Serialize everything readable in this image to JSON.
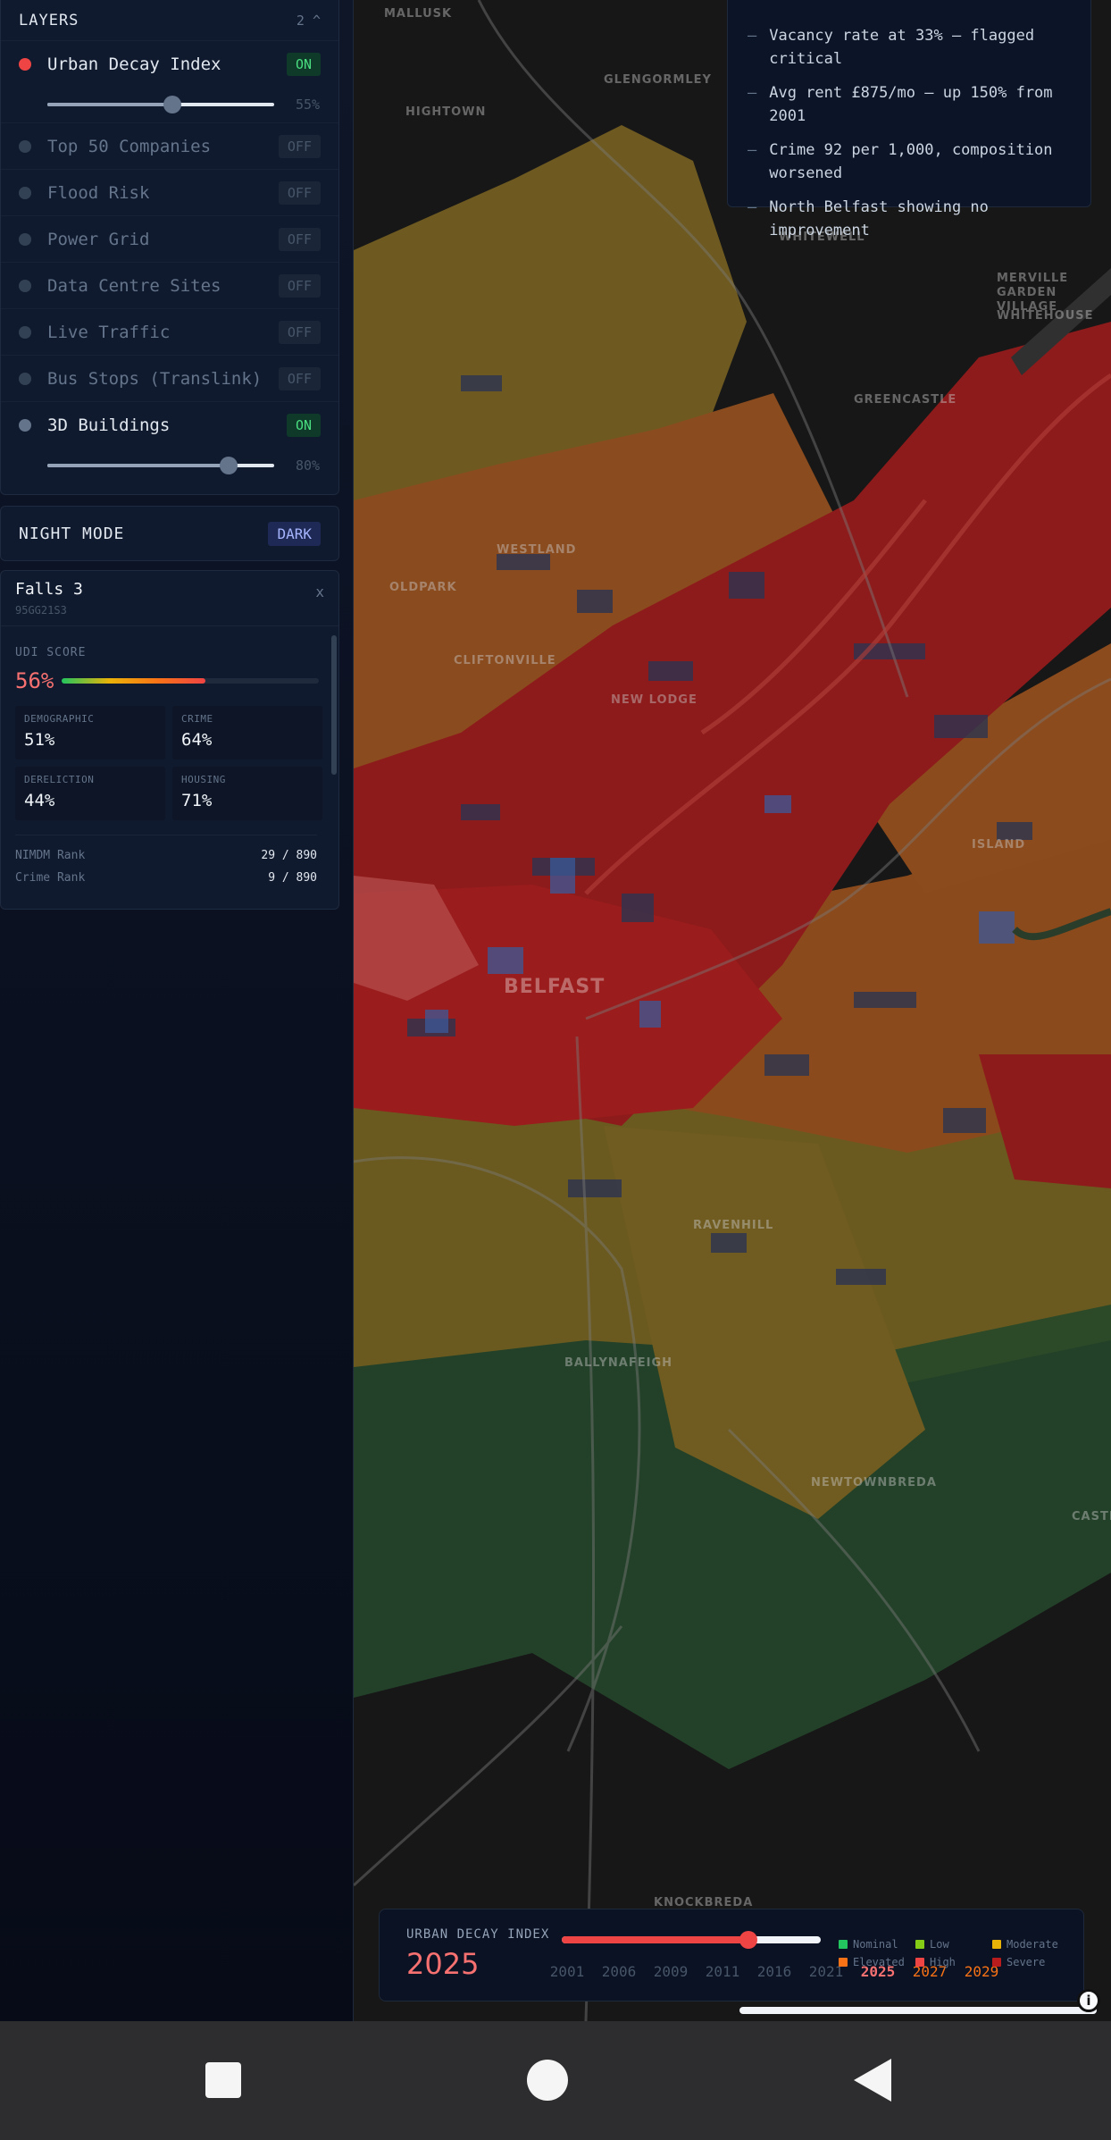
{
  "layers": {
    "title": "LAYERS",
    "count": "2 ^",
    "items": [
      {
        "name": "Urban Decay Index",
        "state": "ON",
        "dot": "red",
        "slider": 0.55,
        "slider_label": "55%"
      },
      {
        "name": "Top 50 Companies",
        "state": "OFF"
      },
      {
        "name": "Flood Risk",
        "state": "OFF"
      },
      {
        "name": "Power Grid",
        "state": "OFF"
      },
      {
        "name": "Data Centre Sites",
        "state": "OFF"
      },
      {
        "name": "Live Traffic",
        "state": "OFF"
      },
      {
        "name": "Bus Stops (Translink)",
        "state": "OFF"
      },
      {
        "name": "3D Buildings",
        "state": "ON",
        "dot": "slate",
        "slider": 0.8,
        "slider_label": "80%"
      }
    ]
  },
  "night_mode": {
    "label": "NIGHT MODE",
    "value": "DARK"
  },
  "detail": {
    "title": "Falls 3",
    "code": "95GG21S3",
    "close": "x",
    "udi_label": "UDI SCORE",
    "udi_value": "56%",
    "udi_fraction": 0.56,
    "metrics": [
      {
        "label": "DEMOGRAPHIC",
        "value": "51%"
      },
      {
        "label": "CRIME",
        "value": "64%"
      },
      {
        "label": "DERELICTION",
        "value": "44%"
      },
      {
        "label": "HOUSING",
        "value": "71%"
      }
    ],
    "ranks": [
      {
        "label": "NIMDM Rank",
        "value": "29 / 890"
      },
      {
        "label": "Crime Rank",
        "value": "9 / 890"
      }
    ]
  },
  "insights": [
    "Vacancy rate at 33% — flagged critical",
    "Avg rent £875/mo — up 150% from 2001",
    "Crime 92 per 1,000, composition worsened",
    "North Belfast showing no improvement"
  ],
  "map": {
    "labels": [
      "MALLUSK",
      "GLENGORMLEY",
      "HIGHTOWN",
      "WHITEWELL",
      "MERVILLE GARDEN VILLAGE",
      "WHITEHOUSE",
      "GREENCASTLE",
      "WESTLAND",
      "OLDPARK",
      "CLIFTONVILLE",
      "NEW LODGE",
      "BELFAST",
      "ISLAND",
      "RAVENHILL",
      "BALLYNAFEIGH",
      "NEWTOWNBREDA",
      "KNOCKBREDA",
      "CASTLEREAGH"
    ],
    "colors": {
      "nominal": "#22c55e",
      "low": "#84cc16",
      "moderate": "#ca8a04",
      "elevated": "#c2410c",
      "high": "#dc2626",
      "severe": "#b91c1c"
    }
  },
  "timeline": {
    "label": "URBAN DECAY INDEX",
    "year": "2025",
    "progress": 0.72,
    "years": [
      "2001",
      "2006",
      "2009",
      "2011",
      "2016",
      "2021",
      "2025",
      "2027",
      "2029"
    ],
    "current": "2025",
    "future": [
      "2027",
      "2029"
    ]
  },
  "legend": [
    {
      "label": "Nominal",
      "color": "#22c55e"
    },
    {
      "label": "Low",
      "color": "#84cc16"
    },
    {
      "label": "Moderate",
      "color": "#eab308"
    },
    {
      "label": "Elevated",
      "color": "#f97316"
    },
    {
      "label": "High",
      "color": "#ef4444"
    },
    {
      "label": "Severe",
      "color": "#b91c1c"
    }
  ],
  "info_icon": "info-icon"
}
